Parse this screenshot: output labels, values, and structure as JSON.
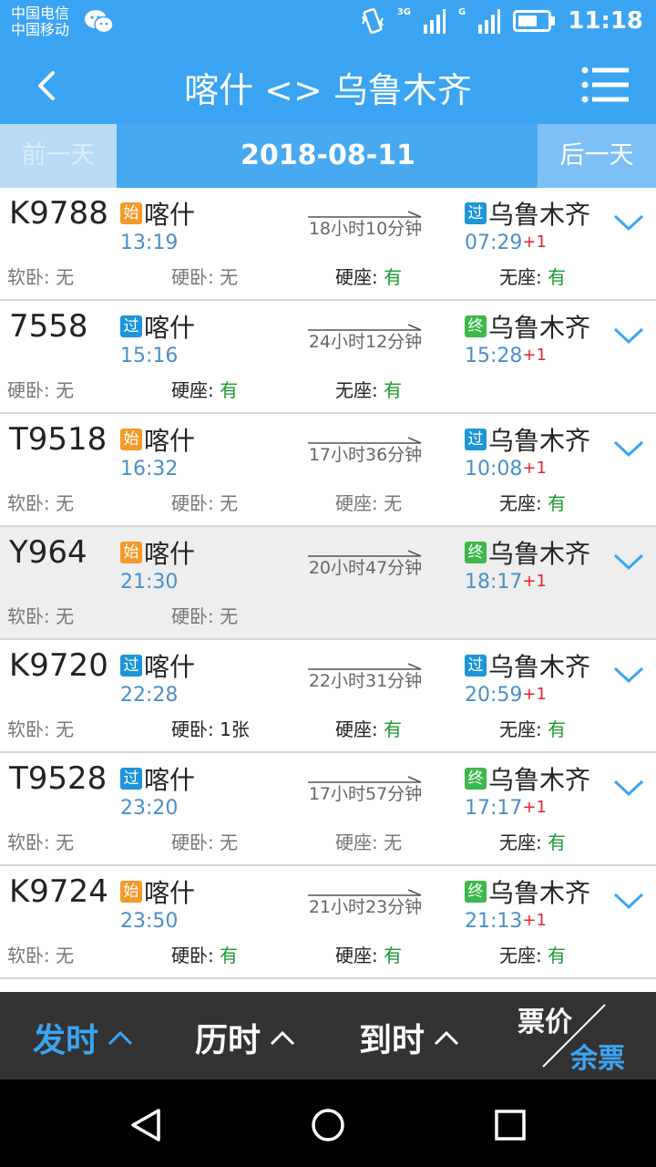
{
  "status": {
    "carrier1": "中国电信",
    "carrier2": "中国移动",
    "net1": "3G",
    "net2": "G",
    "time": "11:18"
  },
  "header": {
    "title": "喀什 <> 乌鲁木齐"
  },
  "datebar": {
    "prev": "前一天",
    "date": "2018-08-11",
    "next": "后一天"
  },
  "trains": [
    {
      "no": "K9788",
      "from_badge": "始",
      "from": "喀什",
      "dep": "13:19",
      "dur": "18小时10分钟",
      "to_badge": "过",
      "to": "乌鲁木齐",
      "arr": "07:29",
      "plus": "+1",
      "seats": [
        {
          "label": "软卧:",
          "val": "无"
        },
        {
          "label": "硬卧:",
          "val": "无"
        },
        {
          "label": "硬座:",
          "val": "有"
        },
        {
          "label": "无座:",
          "val": "有"
        }
      ]
    },
    {
      "no": "7558",
      "from_badge": "过",
      "from": "喀什",
      "dep": "15:16",
      "dur": "24小时12分钟",
      "to_badge": "终",
      "to": "乌鲁木齐",
      "arr": "15:28",
      "plus": "+1",
      "seats": [
        {
          "label": "硬卧:",
          "val": "无"
        },
        {
          "label": "硬座:",
          "val": "有"
        },
        {
          "label": "无座:",
          "val": "有"
        }
      ]
    },
    {
      "no": "T9518",
      "from_badge": "始",
      "from": "喀什",
      "dep": "16:32",
      "dur": "17小时36分钟",
      "to_badge": "过",
      "to": "乌鲁木齐",
      "arr": "10:08",
      "plus": "+1",
      "seats": [
        {
          "label": "软卧:",
          "val": "无"
        },
        {
          "label": "硬卧:",
          "val": "无"
        },
        {
          "label": "硬座:",
          "val": "无"
        },
        {
          "label": "无座:",
          "val": "有"
        }
      ]
    },
    {
      "no": "Y964",
      "from_badge": "始",
      "from": "喀什",
      "dep": "21:30",
      "dur": "20小时47分钟",
      "to_badge": "终",
      "to": "乌鲁木齐",
      "arr": "18:17",
      "plus": "+1",
      "seats": [
        {
          "label": "软卧:",
          "val": "无"
        },
        {
          "label": "硬卧:",
          "val": "无"
        }
      ]
    },
    {
      "no": "K9720",
      "from_badge": "过",
      "from": "喀什",
      "dep": "22:28",
      "dur": "22小时31分钟",
      "to_badge": "过",
      "to": "乌鲁木齐",
      "arr": "20:59",
      "plus": "+1",
      "seats": [
        {
          "label": "软卧:",
          "val": "无"
        },
        {
          "label": "硬卧:",
          "val": "1张"
        },
        {
          "label": "硬座:",
          "val": "有"
        },
        {
          "label": "无座:",
          "val": "有"
        }
      ]
    },
    {
      "no": "T9528",
      "from_badge": "过",
      "from": "喀什",
      "dep": "23:20",
      "dur": "17小时57分钟",
      "to_badge": "终",
      "to": "乌鲁木齐",
      "arr": "17:17",
      "plus": "+1",
      "seats": [
        {
          "label": "软卧:",
          "val": "无"
        },
        {
          "label": "硬卧:",
          "val": "无"
        },
        {
          "label": "硬座:",
          "val": "无"
        },
        {
          "label": "无座:",
          "val": "有"
        }
      ]
    },
    {
      "no": "K9724",
      "from_badge": "始",
      "from": "喀什",
      "dep": "23:50",
      "dur": "21小时23分钟",
      "to_badge": "终",
      "to": "乌鲁木齐",
      "arr": "21:13",
      "plus": "+1",
      "seats": [
        {
          "label": "软卧:",
          "val": "无"
        },
        {
          "label": "硬卧:",
          "val": "有"
        },
        {
          "label": "硬座:",
          "val": "有"
        },
        {
          "label": "无座:",
          "val": "有"
        }
      ]
    }
  ],
  "sortbar": {
    "dep": "发时",
    "dur": "历时",
    "arr": "到时",
    "price": "票价",
    "tickets": "余票"
  },
  "colors": {
    "accent": "#3ba5f3",
    "available": "#1a9a2e",
    "next_day": "#e5242b"
  }
}
